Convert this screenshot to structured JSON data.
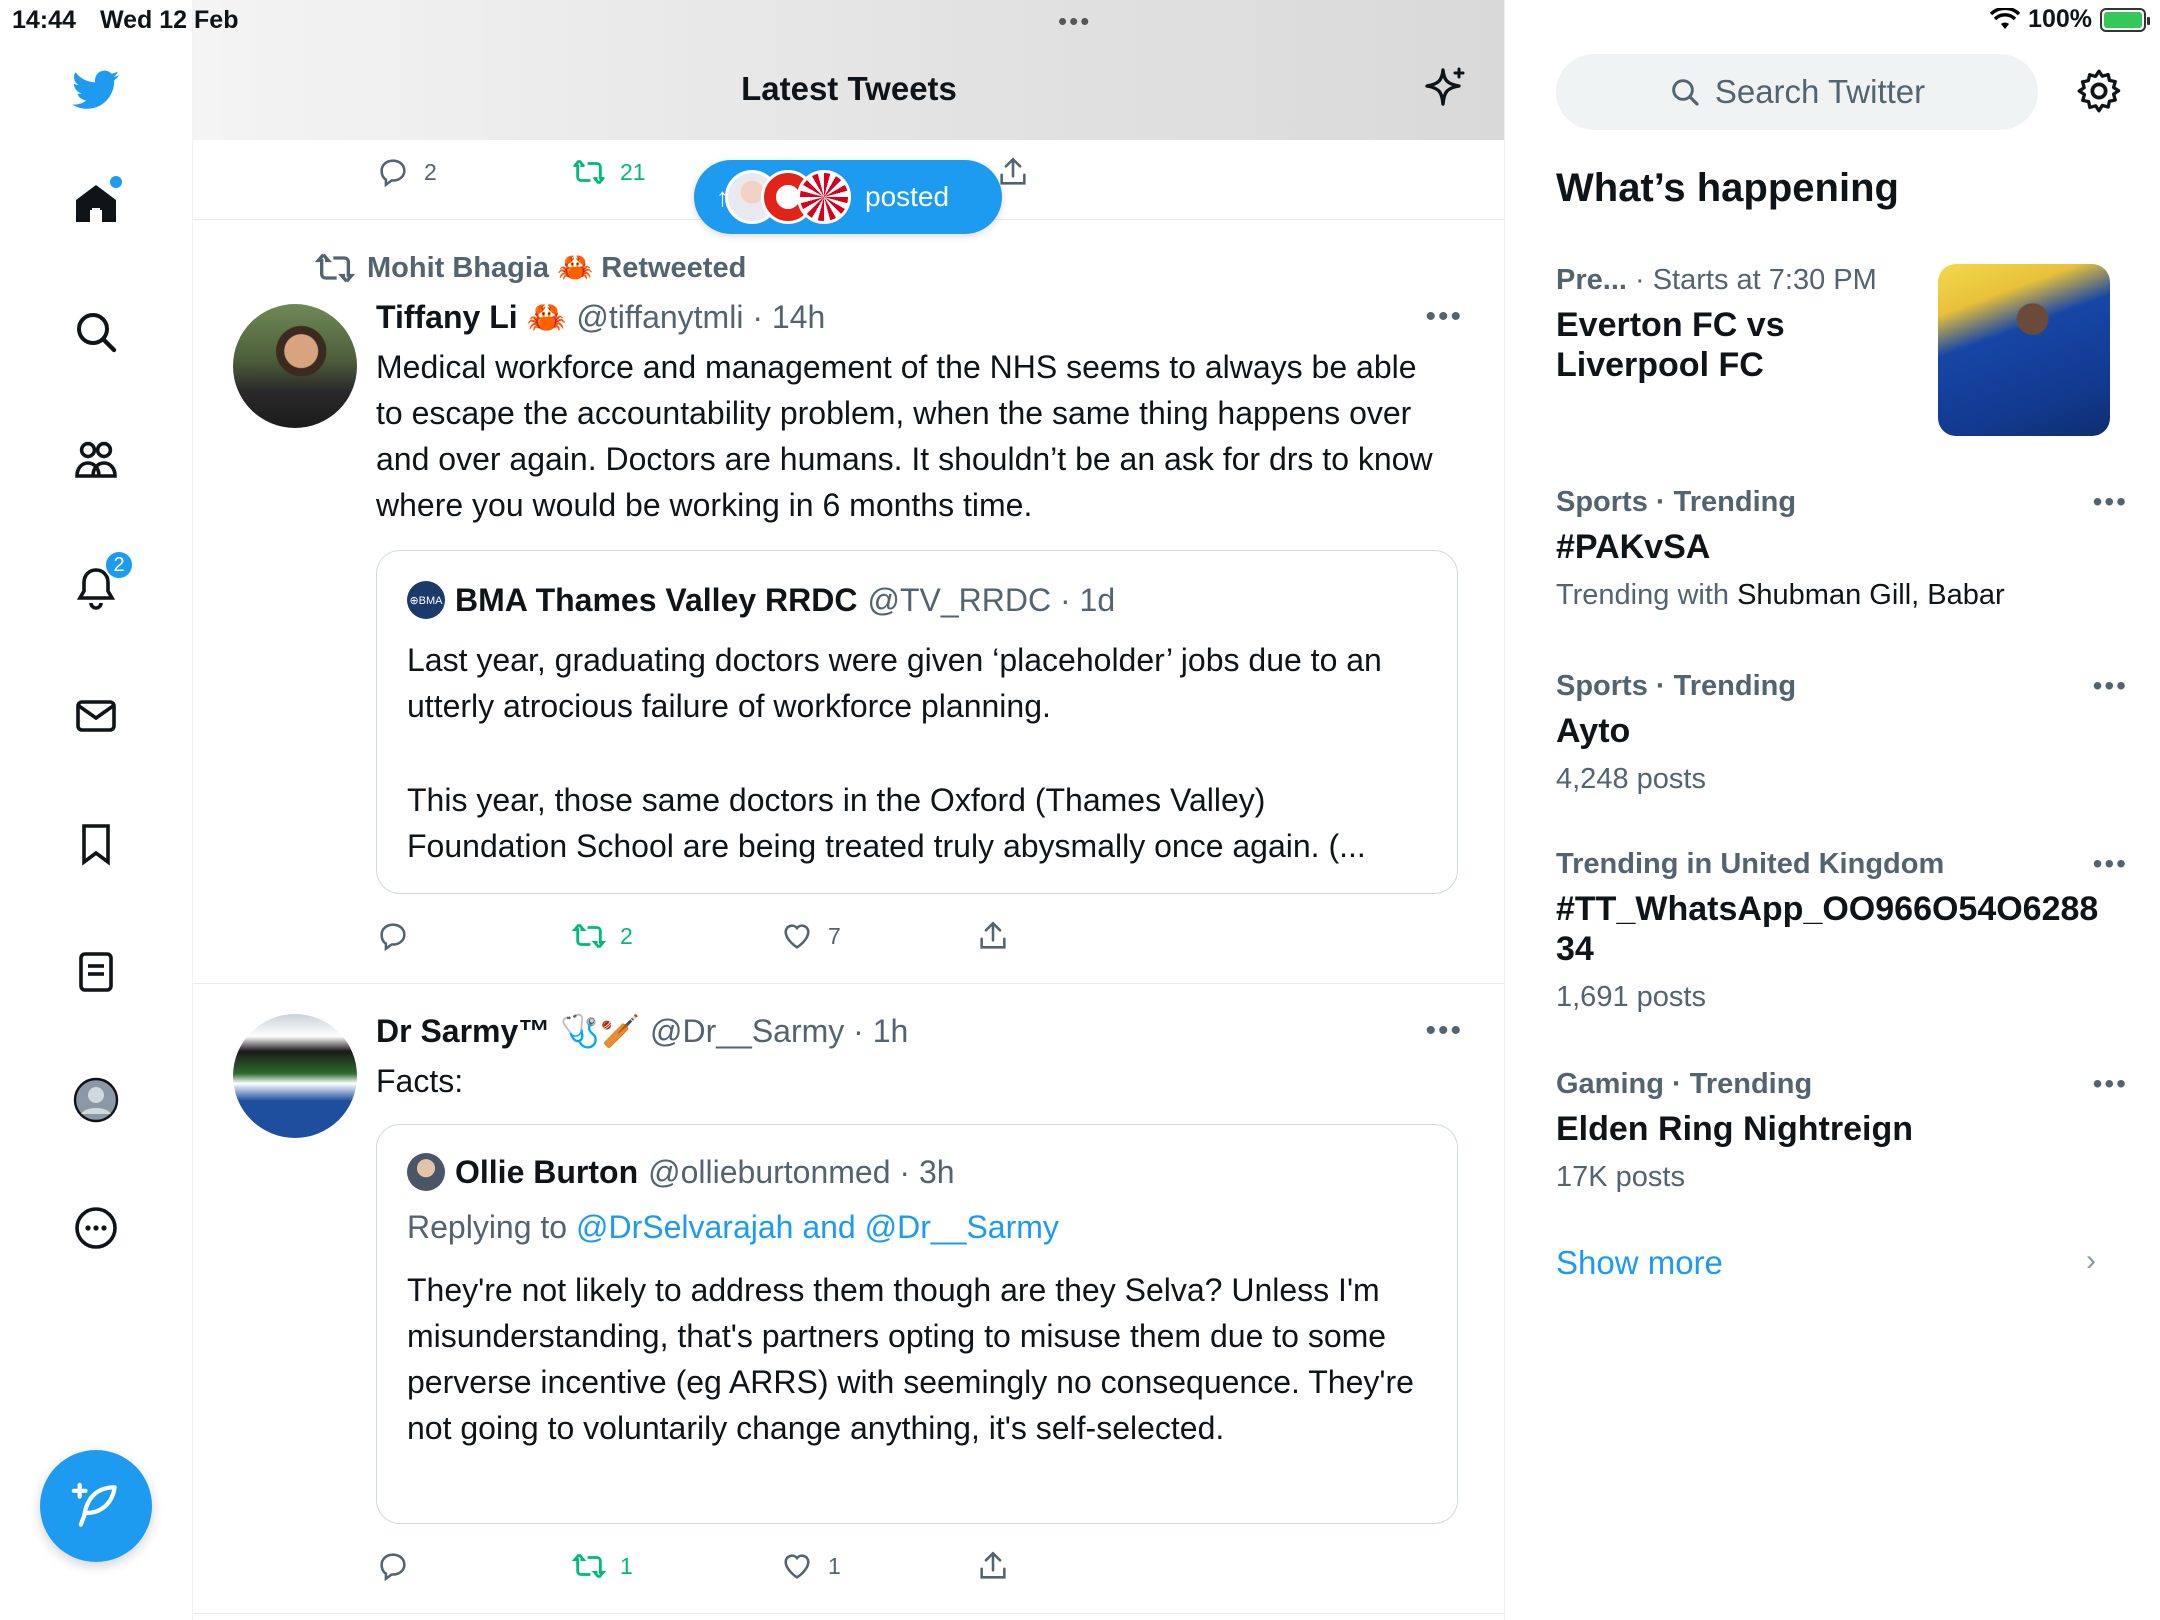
{
  "status": {
    "time": "14:44",
    "date": "Wed 12 Feb",
    "dots": "•••",
    "battery": "100%"
  },
  "nav": {
    "notifications_badge": "2"
  },
  "header": {
    "title": "Latest Tweets"
  },
  "top_actions": {
    "reply": "2",
    "retweet": "21"
  },
  "new_posts": {
    "label": "posted",
    "arrow": "↑"
  },
  "tweet1": {
    "retweeted_by": "Mohit Bhagia 🦀 Retweeted",
    "name": "Tiffany Li 🦀",
    "handle": "@tiffanytmli · 14h",
    "more": "•••",
    "text": "Medical workforce and management of the NHS seems to always be able to escape the accountability problem, when the same thing happens over and over again. Doctors are humans. It shouldn’t be an ask for drs to know where you would be working in 6 months time.",
    "quote": {
      "badge": "⊕BMA",
      "name": "BMA Thames Valley RRDC",
      "handle": "@TV_RRDC · 1d",
      "para1": "Last year, graduating doctors were given ‘placeholder’ jobs due to an utterly atrocious failure of workforce planning.",
      "para2": "This year, those same doctors in the Oxford (Thames Valley) Foundation School are being treated truly abysmally once again. (..."
    },
    "actions": {
      "reply": "",
      "retweet": "2",
      "like": "7"
    }
  },
  "tweet2": {
    "name": "Dr Sarmy™",
    "emoji": "🩺🏏",
    "handle": "@Dr__Sarmy · 1h",
    "more": "•••",
    "text": "Facts:",
    "quote": {
      "name": "Ollie Burton",
      "handle": "@ollieburtonmed · 3h",
      "reply_prefix": "Replying to",
      "reply_targets": "@DrSelvarajah and @Dr__Sarmy",
      "text": "They're not likely to address them though are they Selva? Unless I'm misunderstanding, that's partners opting to misuse them due to some perverse incentive (eg ARRS) with seemingly no consequence. They're not going to voluntarily change anything, it's self-selected."
    },
    "actions": {
      "reply": "",
      "retweet": "1",
      "like": "1"
    }
  },
  "sidebar": {
    "search_placeholder": "Search Twitter",
    "heading": "What’s happening",
    "event": {
      "category": "Pre...",
      "time": "· Starts at 7:30 PM",
      "title": "Everton FC vs Liverpool FC"
    },
    "trends": [
      {
        "meta": "Sports · Trending",
        "title": "#PAKvSA",
        "sub_prefix": "Trending with ",
        "sub_value": "Shubman Gill, Babar",
        "more": "•••"
      },
      {
        "meta": "Sports · Trending",
        "title": "Ayto",
        "sub_prefix": "4,248 posts",
        "sub_value": "",
        "more": "•••"
      },
      {
        "meta": "Trending in United Kingdom",
        "title": "#TT_WhatsApp_OO966O54O628834",
        "sub_prefix": "1,691 posts",
        "sub_value": "",
        "more": "•••"
      },
      {
        "meta": "Gaming · Trending",
        "title": "Elden Ring Nightreign",
        "sub_prefix": "17K posts",
        "sub_value": "",
        "more": "•••"
      }
    ],
    "show_more": "Show more",
    "chevron": "›"
  },
  "colors": {
    "accent": "#1d9bf0",
    "retweet": "#00ba7c",
    "muted": "#536471"
  }
}
